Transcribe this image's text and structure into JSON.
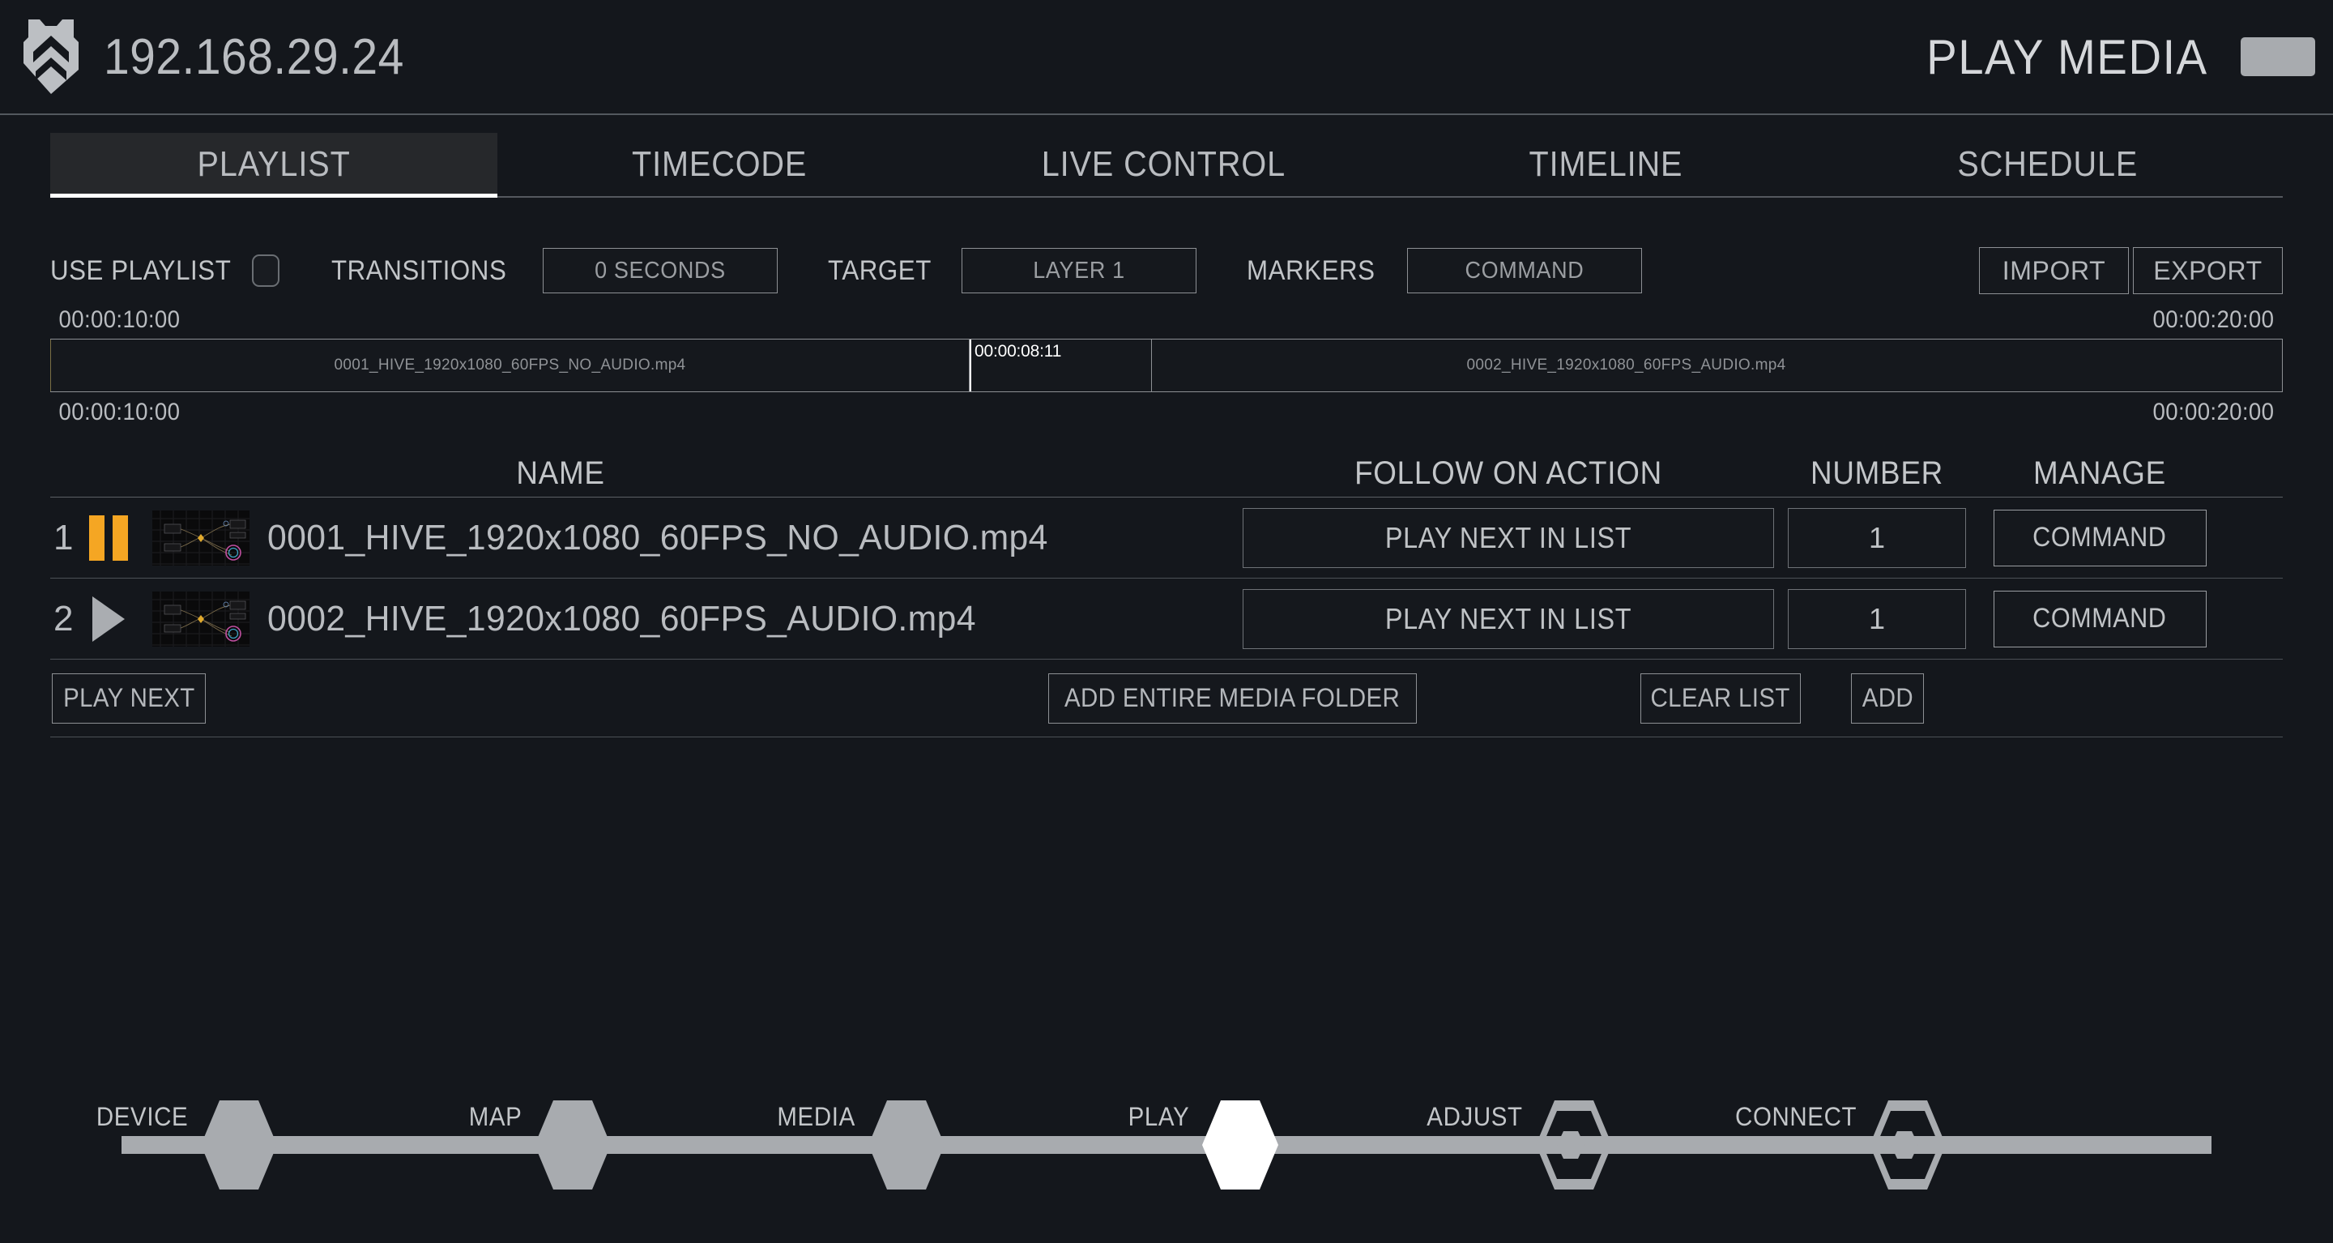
{
  "header": {
    "logo_icon": "hive-shield-logo-icon",
    "ip_address": "192.168.29.24",
    "page_title": "PLAY MEDIA",
    "menu_button_icon": "menu-button"
  },
  "tabs": [
    {
      "label": "PLAYLIST",
      "active": true
    },
    {
      "label": "TIMECODE",
      "active": false
    },
    {
      "label": "LIVE CONTROL",
      "active": false
    },
    {
      "label": "TIMELINE",
      "active": false
    },
    {
      "label": "SCHEDULE",
      "active": false
    }
  ],
  "controls": {
    "use_playlist_label": "USE PLAYLIST",
    "use_playlist_enabled": false,
    "transitions_label": "TRANSITIONS",
    "transitions_value": "0 SECONDS",
    "target_label": "TARGET",
    "target_value": "LAYER 1",
    "markers_label": "MARKERS",
    "markers_value": "COMMAND",
    "import_label": "IMPORT",
    "export_label": "EXPORT"
  },
  "timeline": {
    "top_time_left": "00:00:10:00",
    "top_time_right": "00:00:20:00",
    "bottom_time_left": "00:00:10:00",
    "bottom_time_right": "00:00:20:00",
    "playhead_timecode": "00:00:08:11",
    "clips": [
      {
        "label": "0001_HIVE_1920x1080_60FPS_NO_AUDIO.mp4"
      },
      {
        "label": "0002_HIVE_1920x1080_60FPS_AUDIO.mp4"
      }
    ]
  },
  "playlist": {
    "columns": {
      "name": "NAME",
      "follow_on_action": "FOLLOW ON ACTION",
      "number": "NUMBER",
      "manage": "MANAGE"
    },
    "rows": [
      {
        "index": "1",
        "state_icon": "pause-icon",
        "thumbnail_icon": "video-thumbnail",
        "name": "0001_HIVE_1920x1080_60FPS_NO_AUDIO.mp4",
        "follow_on_action": "PLAY NEXT IN LIST",
        "number": "1",
        "manage": "COMMAND"
      },
      {
        "index": "2",
        "state_icon": "play-icon",
        "thumbnail_icon": "video-thumbnail",
        "name": "0002_HIVE_1920x1080_60FPS_AUDIO.mp4",
        "follow_on_action": "PLAY NEXT IN LIST",
        "number": "1",
        "manage": "COMMAND"
      }
    ],
    "footer": {
      "play_next": "PLAY NEXT",
      "add_entire_media_folder": "ADD ENTIRE MEDIA FOLDER",
      "clear_list": "CLEAR LIST",
      "add": "ADD"
    }
  },
  "wizard": {
    "steps": [
      {
        "label": "DEVICE",
        "state": "complete"
      },
      {
        "label": "MAP",
        "state": "complete"
      },
      {
        "label": "MEDIA",
        "state": "complete"
      },
      {
        "label": "PLAY",
        "state": "current"
      },
      {
        "label": "ADJUST",
        "state": "upcoming"
      },
      {
        "label": "CONNECT",
        "state": "upcoming"
      }
    ]
  },
  "colors": {
    "background": "#14171c",
    "text": "#b9bcc0",
    "accent_orange": "#f5a623",
    "current_step": "#ffffff",
    "rail": "#a8abaf",
    "border": "#8d9094"
  }
}
